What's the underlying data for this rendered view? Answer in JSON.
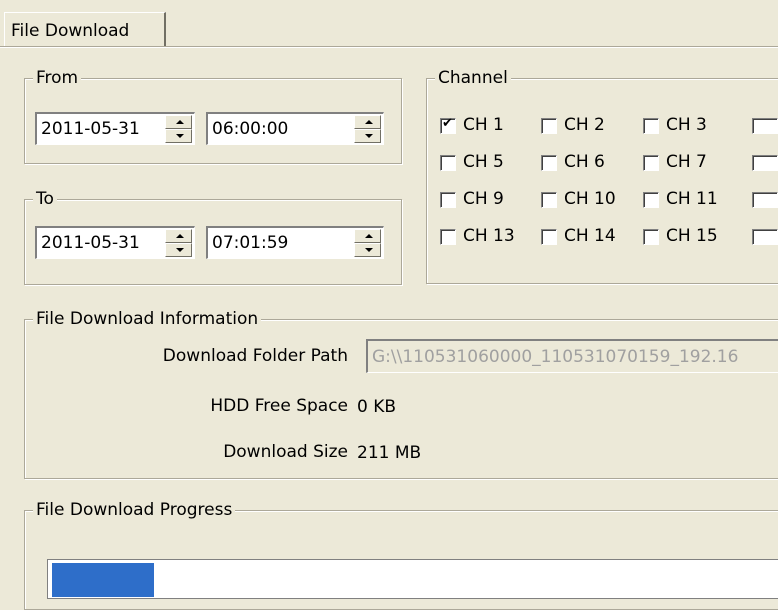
{
  "tab": {
    "label": "File Download"
  },
  "from": {
    "legend": "From",
    "date": "2011-05-31",
    "time": "06:00:00"
  },
  "to": {
    "legend": "To",
    "date": "2011-05-31",
    "time": "07:01:59"
  },
  "channel": {
    "legend": "Channel",
    "items": [
      {
        "label": "CH 1",
        "checked": true
      },
      {
        "label": "CH 2",
        "checked": false
      },
      {
        "label": "CH 3",
        "checked": false
      },
      {
        "label": "CH 5",
        "checked": false
      },
      {
        "label": "CH 6",
        "checked": false
      },
      {
        "label": "CH 7",
        "checked": false
      },
      {
        "label": "CH 9",
        "checked": false
      },
      {
        "label": "CH 10",
        "checked": false
      },
      {
        "label": "CH 11",
        "checked": false
      },
      {
        "label": "CH 13",
        "checked": false
      },
      {
        "label": "CH 14",
        "checked": false
      },
      {
        "label": "CH 15",
        "checked": false
      }
    ]
  },
  "info": {
    "legend": "File Download Information",
    "folder_label": "Download Folder Path",
    "folder_value": "G:\\\\110531060000_110531070159_192.16",
    "free_label": "HDD Free Space",
    "free_value": "0 KB",
    "size_label": "Download Size",
    "size_value": "211 MB"
  },
  "progress": {
    "legend": "File Download Progress",
    "fraction": 0.14,
    "fill_color": "#2e6ec9"
  }
}
